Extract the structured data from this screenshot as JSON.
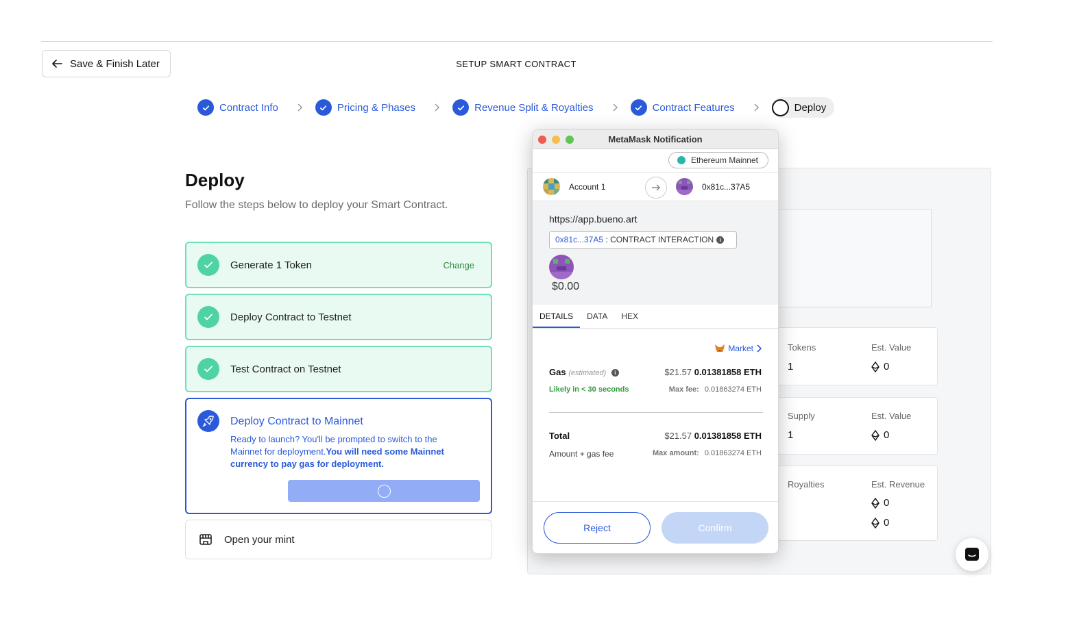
{
  "header": {
    "save_label": "Save & Finish Later",
    "title": "SETUP SMART CONTRACT"
  },
  "stepper": {
    "steps": [
      {
        "label": "Contract Info",
        "status": "done"
      },
      {
        "label": "Pricing & Phases",
        "status": "done"
      },
      {
        "label": "Revenue Split & Royalties",
        "status": "done"
      },
      {
        "label": "Contract Features",
        "status": "done"
      },
      {
        "label": "Deploy",
        "status": "current"
      }
    ]
  },
  "deploy": {
    "title": "Deploy",
    "subtitle": "Follow the steps below to deploy your Smart Contract.",
    "tasks": [
      {
        "label": "Generate 1 Token",
        "action": "Change"
      },
      {
        "label": "Deploy Contract to Testnet"
      },
      {
        "label": "Test Contract on Testnet"
      }
    ],
    "active": {
      "title": "Deploy Contract to Mainnet",
      "desc": "Ready to launch? You'll be prompted to switch to the Mainnet for deployment.",
      "desc_bold": "You will need some Mainnet currency to pay gas for deployment."
    },
    "mint_label": "Open your mint"
  },
  "summary": {
    "row1": {
      "label_a": "Tokens",
      "value_a": "1",
      "label_b": "Est. Value",
      "value_b": "0"
    },
    "row2": {
      "label_a": "Supply",
      "value_a": "1",
      "label_b": "Est. Value",
      "value_b": "0"
    },
    "row3": {
      "label_a": "Royalties",
      "label_b": "Est. Revenue",
      "value_b1": "0",
      "value_b2": "0"
    }
  },
  "metamask": {
    "window_title": "MetaMask Notification",
    "network": "Ethereum Mainnet",
    "from_account": "Account 1",
    "to_account": "0x81c...37A5",
    "origin": "https://app.bueno.art",
    "contract_addr": "0x81c...37A5",
    "contract_label": " : CONTRACT INTERACTION",
    "amount": "$0.00",
    "tabs": [
      "DETAILS",
      "DATA",
      "HEX"
    ],
    "market": "Market",
    "gas_label": "Gas",
    "gas_est": "(estimated)",
    "gas_usd": "$21.57",
    "gas_eth": "0.01381858 ETH",
    "likely": "Likely in < 30 seconds",
    "max_fee_label": "Max fee:",
    "max_fee": "0.01863274 ETH",
    "total_label": "Total",
    "total_usd": "$21.57",
    "total_eth": "0.01381858 ETH",
    "amount_gas_label": "Amount + gas fee",
    "max_amount_label": "Max amount:",
    "max_amount": "0.01863274 ETH",
    "reject_label": "Reject",
    "confirm_label": "Confirm"
  },
  "colors": {
    "accent": "#2a5ada",
    "success_bg": "#e9faf3",
    "success_border": "#6fe0b7",
    "success_icon": "#4fd3a4"
  }
}
